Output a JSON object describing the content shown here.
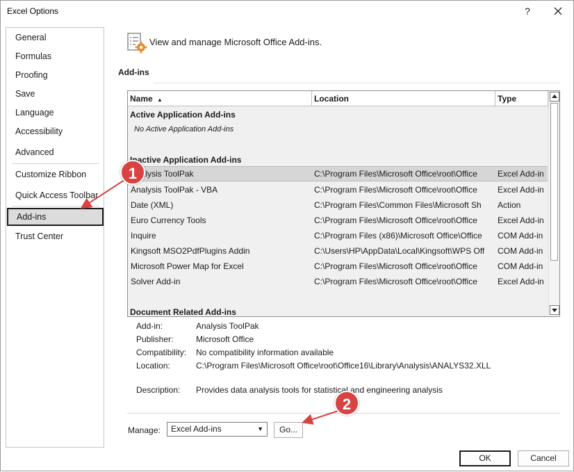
{
  "window": {
    "title": "Excel Options",
    "help_glyph": "?"
  },
  "sidebar": {
    "items": [
      {
        "label": "General"
      },
      {
        "label": "Formulas"
      },
      {
        "label": "Proofing"
      },
      {
        "label": "Save"
      },
      {
        "label": "Language"
      },
      {
        "label": "Accessibility"
      },
      {
        "label": "Advanced"
      },
      {
        "label": "Customize Ribbon"
      },
      {
        "label": "Quick Access Toolbar"
      },
      {
        "label": "Add-ins",
        "selected": true
      },
      {
        "label": "Trust Center"
      }
    ]
  },
  "header": {
    "text": "View and manage Microsoft Office Add-ins.",
    "icon": "addin-gear-icon"
  },
  "section": {
    "title": "Add-ins"
  },
  "table": {
    "columns": [
      "Name",
      "Location",
      "Type"
    ],
    "sort_glyph": "▲",
    "active_group": "Active Application Add-ins",
    "active_empty": "No Active Application Add-ins",
    "inactive_group": "Inactive Application Add-ins",
    "inactive_rows": [
      {
        "name": "Analysis ToolPak",
        "location": "C:\\Program Files\\Microsoft Office\\root\\Office",
        "type": "Excel Add-in"
      },
      {
        "name": "Analysis ToolPak - VBA",
        "location": "C:\\Program Files\\Microsoft Office\\root\\Office",
        "type": "Excel Add-in"
      },
      {
        "name": "Date (XML)",
        "location": "C:\\Program Files\\Common Files\\Microsoft Sh",
        "type": "Action"
      },
      {
        "name": "Euro Currency Tools",
        "location": "C:\\Program Files\\Microsoft Office\\root\\Office",
        "type": "Excel Add-in"
      },
      {
        "name": "Inquire",
        "location": "C:\\Program Files (x86)\\Microsoft Office\\Office",
        "type": "COM Add-in"
      },
      {
        "name": "Kingsoft MSO2PdfPlugins Addin",
        "location": "C:\\Users\\HP\\AppData\\Local\\Kingsoft\\WPS Off",
        "type": "COM Add-in"
      },
      {
        "name": "Microsoft Power Map for Excel",
        "location": "C:\\Program Files\\Microsoft Office\\root\\Office",
        "type": "COM Add-in"
      },
      {
        "name": "Solver Add-in",
        "location": "C:\\Program Files\\Microsoft Office\\root\\Office",
        "type": "Excel Add-in"
      }
    ],
    "doc_group": "Document Related Add-ins"
  },
  "details": {
    "addin_label": "Add-in:",
    "addin_value": "Analysis ToolPak",
    "publisher_label": "Publisher:",
    "publisher_value": "Microsoft Office",
    "compat_label": "Compatibility:",
    "compat_value": "No compatibility information available",
    "location_label": "Location:",
    "location_value": "C:\\Program Files\\Microsoft Office\\root\\Office16\\Library\\Analysis\\ANALYS32.XLL",
    "desc_label": "Description:",
    "desc_value": "Provides data analysis tools for statistical and engineering analysis"
  },
  "manage": {
    "label": "Manage:",
    "selected": "Excel Add-ins",
    "go_label": "Go..."
  },
  "footer": {
    "ok_label": "OK",
    "cancel_label": "Cancel"
  },
  "annotations": {
    "badge1": "1",
    "badge2": "2",
    "color": "#d74343"
  }
}
